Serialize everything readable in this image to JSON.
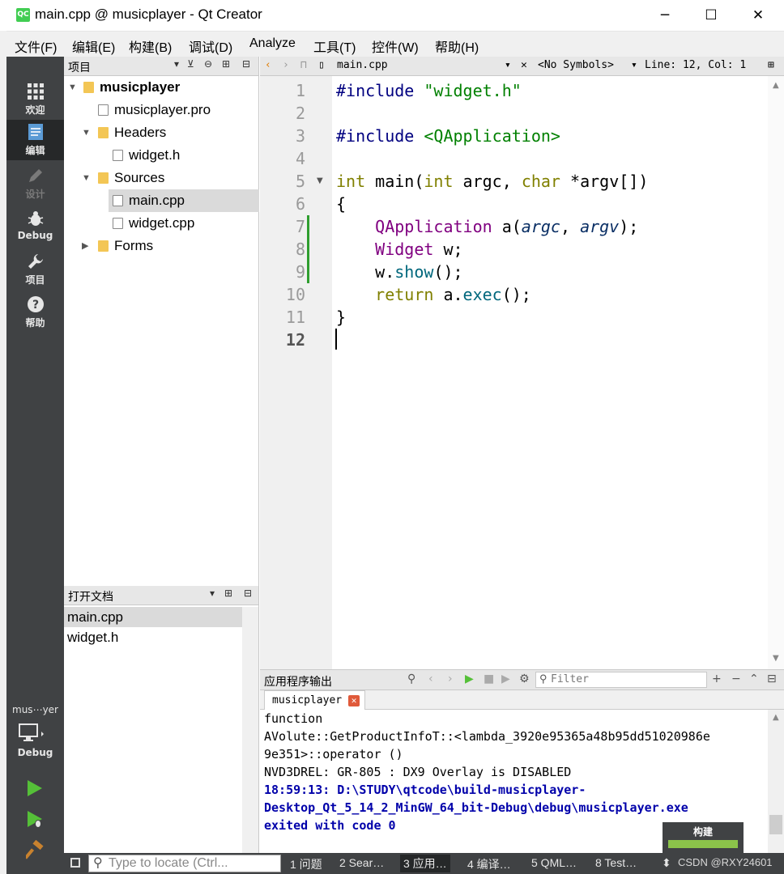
{
  "window": {
    "title": "main.cpp @ musicplayer - Qt Creator",
    "app_icon": "QC",
    "minimize": "─",
    "maximize": "☐",
    "close": "✕"
  },
  "menu": [
    "文件(F)",
    "编辑(E)",
    "构建(B)",
    "调试(D)",
    "Analyze",
    "工具(T)",
    "控件(W)",
    "帮助(H)"
  ],
  "modes": [
    {
      "label": "欢迎",
      "icon": "welcome-grid-icon"
    },
    {
      "label": "编辑",
      "icon": "edit-document-icon"
    },
    {
      "label": "设计",
      "icon": "design-pencil-icon"
    },
    {
      "label": "Debug",
      "icon": "debug-bug-icon"
    },
    {
      "label": "项目",
      "icon": "project-wrench-icon"
    },
    {
      "label": "帮助",
      "icon": "help-question-icon"
    }
  ],
  "project_pane": {
    "title": "项目",
    "tree": [
      {
        "label": "musicplayer",
        "kind": "project"
      },
      {
        "label": "musicplayer.pro",
        "kind": "pro-file"
      },
      {
        "label": "Headers",
        "kind": "folder"
      },
      {
        "label": "widget.h",
        "kind": "header-file"
      },
      {
        "label": "Sources",
        "kind": "folder"
      },
      {
        "label": "main.cpp",
        "kind": "source-file"
      },
      {
        "label": "widget.cpp",
        "kind": "source-file"
      },
      {
        "label": "Forms",
        "kind": "folder"
      }
    ]
  },
  "open_docs": {
    "title": "打开文档",
    "items": [
      "main.cpp",
      "widget.h"
    ]
  },
  "editor_toolbar": {
    "file": "main.cpp",
    "symbols": "<No Symbols>",
    "position": "Line: 12, Col: 1"
  },
  "editor": {
    "line_numbers": [
      "1",
      "2",
      "3",
      "4",
      "5",
      "6",
      "7",
      "8",
      "9",
      "10",
      "11",
      "12"
    ],
    "current_line": 12,
    "code": {
      "l1_directive": "#include",
      "l1_file": "\"widget.h\"",
      "l3_directive": "#include",
      "l3_file": "<QApplication>",
      "l5_int": "int",
      "l5_main": "main(",
      "l5_int2": "int",
      "l5_argc": " argc, ",
      "l5_char": "char",
      "l5_argv": " *argv[])",
      "l6": "{",
      "l7_type": "QApplication",
      "l7_a": " a(",
      "l7_argc": "argc",
      "l7_comma": ", ",
      "l7_argv": "argv",
      "l7_end": ");",
      "l8_type": "Widget",
      "l8_w": " w;",
      "l9_w": "w.",
      "l9_show": "show",
      "l9_end": "();",
      "l10_return": "return",
      "l10_a": " a.",
      "l10_exec": "exec",
      "l10_end": "();",
      "l11": "}"
    }
  },
  "output_pane": {
    "title": "应用程序输出",
    "filter_placeholder": "Filter",
    "tab_label": "musicplayer",
    "lines": [
      "function",
      "AVolute::GetProductInfoT::<lambda_3920e95365a48b95dd51020986e",
      "9e351>::operator ()",
      "NVD3DREL: GR-805 : DX9 Overlay is DISABLED",
      "18:59:13: D:\\STUDY\\qtcode\\build-musicplayer-",
      "Desktop_Qt_5_14_2_MinGW_64_bit-Debug\\debug\\musicplayer.exe",
      "exited with code 0"
    ]
  },
  "build_progress": {
    "label": "构建",
    "fraction": 1.0
  },
  "target_selector": {
    "name": "mus⋯yer",
    "kit": "Debug"
  },
  "statusbar": {
    "locator_placeholder": "Type to locate (Ctrl...",
    "tabs": [
      "1 问题",
      "2 Sear…",
      "3 应用…",
      "4 编译…",
      "5 QML…",
      "8 Test…"
    ],
    "active_tab": 2,
    "watermark": "CSDN @RXY24601"
  },
  "colors": {
    "modebar": "#404244",
    "accent_green": "#2f9e2f",
    "keyword": "#808000",
    "type": "#800080",
    "string": "#008000"
  }
}
